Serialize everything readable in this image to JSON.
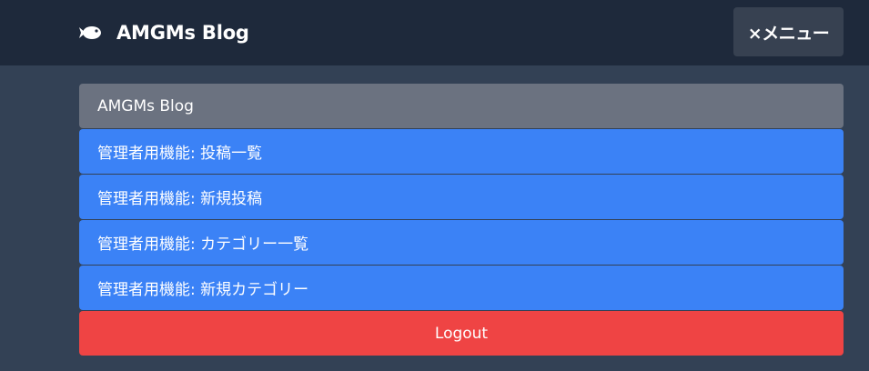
{
  "header": {
    "brand_title": "AMGMs Blog",
    "brand_icon": "fish-icon",
    "menu_button_label": "×メニュー"
  },
  "menu": {
    "items": [
      {
        "label": "AMGMs Blog",
        "color": "#6b7280"
      },
      {
        "label": "管理者用機能: 投稿一覧",
        "color": "#3b82f6"
      },
      {
        "label": "管理者用機能: 新規投稿",
        "color": "#3b82f6"
      },
      {
        "label": "管理者用機能: カテゴリー一覧",
        "color": "#3b82f6"
      },
      {
        "label": "管理者用機能: 新規カテゴリー",
        "color": "#3b82f6"
      }
    ],
    "logout_label": "Logout",
    "logout_color": "#ef4444"
  },
  "colors": {
    "page_background": "#334155",
    "header_background": "#1e293b",
    "menu_button_background": "#374151"
  }
}
